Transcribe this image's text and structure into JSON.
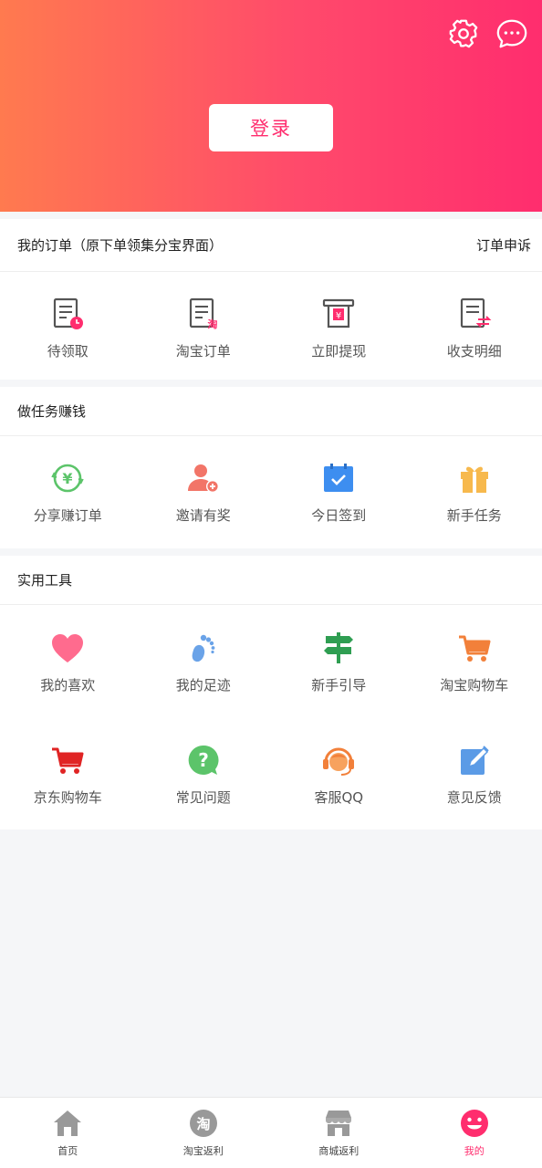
{
  "header": {
    "login_label": "登录",
    "icons": [
      "gear-icon",
      "chat-bubble-icon"
    ]
  },
  "orders": {
    "title": "我的订单（原下单领集分宝界面）",
    "appeal_link": "订单申诉",
    "items": [
      {
        "label": "待领取",
        "icon": "pending-order-icon"
      },
      {
        "label": "淘宝订单",
        "icon": "taobao-order-icon"
      },
      {
        "label": "立即提现",
        "icon": "withdraw-icon"
      },
      {
        "label": "收支明细",
        "icon": "transaction-detail-icon"
      }
    ]
  },
  "tasks": {
    "title": "做任务赚钱",
    "items": [
      {
        "label": "分享赚订单",
        "icon": "share-earn-icon"
      },
      {
        "label": "邀请有奖",
        "icon": "invite-icon"
      },
      {
        "label": "今日签到",
        "icon": "calendar-check-icon"
      },
      {
        "label": "新手任务",
        "icon": "gift-icon"
      }
    ]
  },
  "tools": {
    "title": "实用工具",
    "items": [
      {
        "label": "我的喜欢",
        "icon": "heart-icon"
      },
      {
        "label": "我的足迹",
        "icon": "footprint-icon"
      },
      {
        "label": "新手引导",
        "icon": "signpost-icon"
      },
      {
        "label": "淘宝购物车",
        "icon": "cart-icon"
      },
      {
        "label": "京东购物车",
        "icon": "cart-icon"
      },
      {
        "label": "常见问题",
        "icon": "question-icon"
      },
      {
        "label": "客服QQ",
        "icon": "headset-icon"
      },
      {
        "label": "意见反馈",
        "icon": "edit-feedback-icon"
      }
    ]
  },
  "tabbar": {
    "items": [
      {
        "label": "首页",
        "icon": "home-icon"
      },
      {
        "label": "淘宝返利",
        "icon": "taobao-rebate-icon"
      },
      {
        "label": "商城返利",
        "icon": "store-icon"
      },
      {
        "label": "我的",
        "icon": "smiley-icon"
      }
    ],
    "active_index": 3
  },
  "colors": {
    "accent": "#ff2d6e",
    "gradient_start": "#ff7a4f",
    "gradient_end": "#ff2d6e"
  }
}
